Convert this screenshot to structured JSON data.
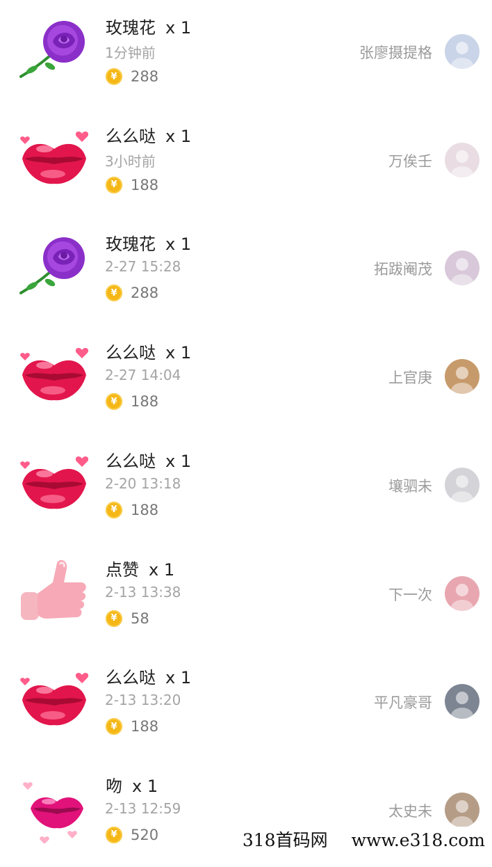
{
  "records": [
    {
      "gift": "rose",
      "title": "玫瑰花",
      "count": "x 1",
      "time": "1分钟前",
      "price": "288",
      "sender": "张廖摄提格",
      "avatar_color": "#c9d4e8"
    },
    {
      "gift": "kiss",
      "title": "么么哒",
      "count": "x 1",
      "time": "3小时前",
      "price": "188",
      "sender": "万俟壬",
      "avatar_color": "#e9dde3"
    },
    {
      "gift": "rose",
      "title": "玫瑰花",
      "count": "x 1",
      "time": "2-27 15:28",
      "price": "288",
      "sender": "拓跋阉茂",
      "avatar_color": "#d8c8d9"
    },
    {
      "gift": "kiss",
      "title": "么么哒",
      "count": "x 1",
      "time": "2-27 14:04",
      "price": "188",
      "sender": "上官庚",
      "avatar_color": "#c79a6b"
    },
    {
      "gift": "kiss",
      "title": "么么哒",
      "count": "x 1",
      "time": "2-20 13:18",
      "price": "188",
      "sender": "壤驷未",
      "avatar_color": "#d3d3d8"
    },
    {
      "gift": "thumb",
      "title": "点赞",
      "count": "x 1",
      "time": "2-13 13:38",
      "price": "58",
      "sender": "下一次",
      "avatar_color": "#e8a7b0"
    },
    {
      "gift": "kiss",
      "title": "么么哒",
      "count": "x 1",
      "time": "2-13 13:20",
      "price": "188",
      "sender": "平凡豪哥",
      "avatar_color": "#7d8593"
    },
    {
      "gift": "lips",
      "title": "吻",
      "count": "x 1",
      "time": "2-13 12:59",
      "price": "520",
      "sender": "太史未",
      "avatar_color": "#b59c86"
    }
  ],
  "coin_symbol": "¥",
  "watermark": {
    "left": "318首码网",
    "right": "www.e318.com"
  }
}
